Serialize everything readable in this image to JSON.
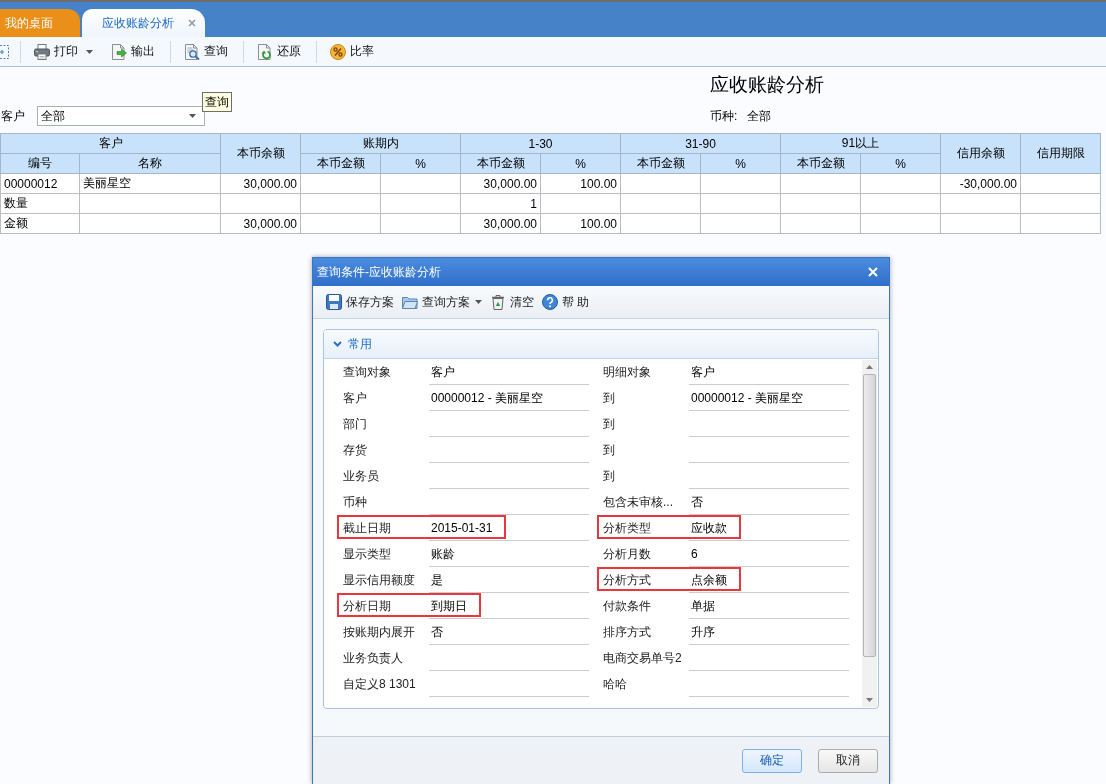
{
  "tabs": [
    {
      "label": "我的桌面",
      "selected": false,
      "closable": false
    },
    {
      "label": "应收账龄分析",
      "selected": true,
      "closable": true
    }
  ],
  "toolbar": {
    "groups": [
      [
        {
          "label": "打印",
          "dropdown": true
        },
        {
          "label": "输出",
          "dropdown": false
        }
      ],
      [
        {
          "label": "查询",
          "dropdown": false
        }
      ],
      [
        {
          "label": "还原",
          "dropdown": false
        }
      ],
      [
        {
          "label": "比率",
          "dropdown": false
        }
      ]
    ]
  },
  "tooltip": {
    "text": "查询"
  },
  "report": {
    "title": "应收账龄分析",
    "filter": {
      "label": "客户",
      "value": "全部"
    },
    "currency": {
      "label": "币种:",
      "value": "全部"
    }
  },
  "table": {
    "header_groups": [
      {
        "label": "客户",
        "columns": [
          "编号",
          "名称"
        ]
      },
      {
        "label": "本币余额"
      },
      {
        "label": "账期内",
        "columns": [
          "本币金额",
          "%"
        ]
      },
      {
        "label": "1-30",
        "columns": [
          "本币金额",
          "%"
        ]
      },
      {
        "label": "31-90",
        "columns": [
          "本币金额",
          "%"
        ]
      },
      {
        "label": "91以上",
        "columns": [
          "本币金额",
          "%"
        ]
      },
      {
        "label": "信用余额"
      },
      {
        "label": "信用期限"
      }
    ],
    "rows": [
      [
        "00000012",
        "美丽星空",
        "30,000.00",
        null,
        null,
        "30,000.00",
        "100.00",
        null,
        null,
        null,
        null,
        "-30,000.00",
        null
      ],
      [
        "数量",
        null,
        null,
        null,
        null,
        "1",
        null,
        null,
        null,
        null,
        null,
        null,
        null
      ],
      [
        "金额",
        null,
        "30,000.00",
        null,
        null,
        "30,000.00",
        "100.00",
        null,
        null,
        null,
        null,
        null,
        null
      ]
    ]
  },
  "dialog": {
    "title": "查询条件-应收账龄分析",
    "toolbar": [
      {
        "label": "保存方案",
        "dropdown": false
      },
      {
        "label": "查询方案",
        "dropdown": true
      },
      {
        "label": "清空",
        "dropdown": false
      },
      {
        "label": "帮 助",
        "dropdown": false
      }
    ],
    "section": {
      "title": "常用",
      "expanded": true
    },
    "fields": [
      {
        "label": "查询对象",
        "value": "客户",
        "highlighted": false
      },
      {
        "label": "明细对象",
        "value": "客户",
        "highlighted": false
      },
      {
        "label": "客户",
        "value": "00000012 - 美丽星空",
        "highlighted": false
      },
      {
        "label": "到",
        "value": "00000012 - 美丽星空",
        "highlighted": false
      },
      {
        "label": "部门",
        "highlighted": false
      },
      {
        "label": "到",
        "highlighted": false
      },
      {
        "label": "存货",
        "highlighted": false
      },
      {
        "label": "到",
        "highlighted": false
      },
      {
        "label": "业务员",
        "highlighted": false
      },
      {
        "label": "到",
        "highlighted": false
      },
      {
        "label": "币种",
        "highlighted": false
      },
      {
        "label": "包含未审核...",
        "value": "否",
        "highlighted": false
      },
      {
        "label": "截止日期",
        "value": "2015-01-31",
        "highlighted": true
      },
      {
        "label": "分析类型",
        "value": "应收款",
        "highlighted": true
      },
      {
        "label": "显示类型",
        "value": "账龄",
        "highlighted": false
      },
      {
        "label": "分析月数",
        "value": "6",
        "highlighted": false
      },
      {
        "label": "显示信用额度",
        "value": "是",
        "highlighted": false
      },
      {
        "label": "分析方式",
        "value": "点余额",
        "highlighted": true
      },
      {
        "label": "分析日期",
        "value": "到期日",
        "highlighted": true
      },
      {
        "label": "付款条件",
        "value": "单据",
        "highlighted": false
      },
      {
        "label": "按账期内展开",
        "value": "否",
        "highlighted": false
      },
      {
        "label": "排序方式",
        "value": "升序",
        "highlighted": false
      },
      {
        "label": "业务负责人",
        "highlighted": false
      },
      {
        "label": "电商交易单号2",
        "highlighted": false
      },
      {
        "label": "自定义8 1301",
        "highlighted": false
      },
      {
        "label": "哈哈",
        "highlighted": false
      }
    ],
    "buttons": [
      {
        "label": "确定",
        "default": true
      },
      {
        "label": "取消",
        "default": false
      }
    ]
  }
}
